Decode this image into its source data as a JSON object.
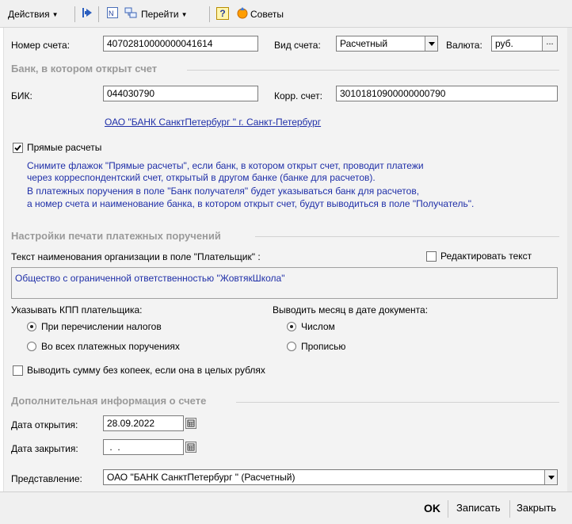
{
  "toolbar": {
    "actions_label": "Действия",
    "goto_label": "Перейти",
    "help_label": "?",
    "tips_label": "Советы"
  },
  "account": {
    "number_label": "Номер счета:",
    "number_value": "40702810000000041614",
    "type_label": "Вид счета:",
    "type_value": "Расчетный",
    "currency_label": "Валюта:",
    "currency_value": "руб.",
    "currency_btn": "..."
  },
  "bank_section": {
    "title": "Банк, в котором открыт счет",
    "bik_label": "БИК:",
    "bik_value": "044030790",
    "corr_label": "Корр. счет:",
    "corr_value": "30101810900000000790",
    "bank_link": "ОАО \"БАНК СанктПетербург \" г. Санкт-Петербург"
  },
  "direct": {
    "checkbox_label": "Прямые расчеты",
    "checked": true,
    "hint_lines": [
      "Снимите флажок \"Прямые расчеты\", если банк, в котором открыт счет, проводит платежи",
      "через корреспондентский счет, открытый в другом банке (банке для расчетов).",
      "В платежных поручения в поле \"Банк получателя\" будет указываться банк для расчетов,",
      "а номер счета и наименование банка, в котором открыт счет, будут выводиться в поле \"Получатель\"."
    ]
  },
  "print_section": {
    "title": "Настройки печати платежных поручений",
    "payer_text_label": "Текст наименования организации в поле \"Плательщик\" :",
    "edit_text_label": "Редактировать текст",
    "payer_text_value": "Общество с ограниченной ответственностью \"ЖовтякШкола\"",
    "kpp_label": "Указывать КПП плательщика:",
    "kpp_options": [
      "При перечислении налогов",
      "Во всех платежных поручениях"
    ],
    "month_label": "Выводить месяц в дате документа:",
    "month_options": [
      "Числом",
      "Прописью"
    ],
    "no_kopecks_label": "Выводить сумму без копеек, если она в целых рублях"
  },
  "extra_section": {
    "title": "Дополнительная информация о счете",
    "open_date_label": "Дата открытия:",
    "open_date_value": "28.09.2022",
    "close_date_label": "Дата закрытия:",
    "close_date_value": " .  .",
    "presentation_label": "Представление:",
    "presentation_value": "ОАО \"БАНК СанктПетербург \" (Расчетный)"
  },
  "footer": {
    "ok_label": "OK",
    "save_label": "Записать",
    "close_label": "Закрыть"
  },
  "colors": {
    "link_blue": "#1f2fa8",
    "section_gray": "#9a9a9a"
  }
}
